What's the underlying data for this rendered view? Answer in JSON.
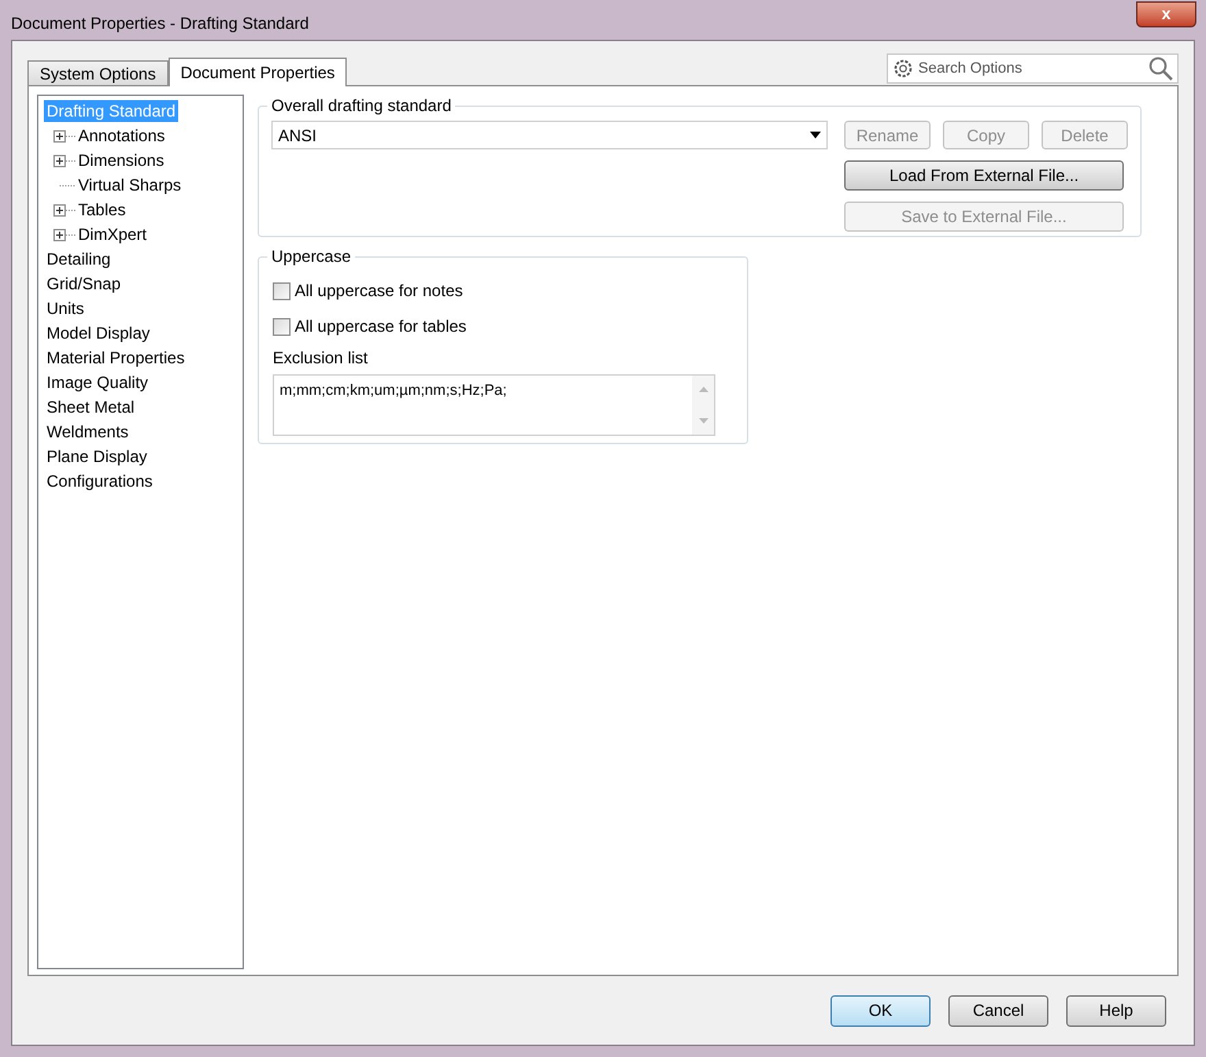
{
  "window": {
    "title": "Document Properties - Drafting Standard",
    "close_label": "x"
  },
  "tabs": [
    {
      "label": "System Options",
      "selected": false
    },
    {
      "label": "Document Properties",
      "selected": true
    }
  ],
  "search": {
    "placeholder": "Search Options"
  },
  "tree": [
    {
      "label": "Drafting Standard",
      "selected": true,
      "children": [
        {
          "label": "Annotations",
          "kind": "expandable",
          "selected": false
        },
        {
          "label": "Dimensions",
          "kind": "expandable",
          "selected": false
        },
        {
          "label": "Virtual Sharps",
          "kind": "leaf",
          "selected": false
        },
        {
          "label": "Tables",
          "kind": "expandable",
          "selected": false
        },
        {
          "label": "DimXpert",
          "kind": "expandable",
          "selected": false
        }
      ]
    },
    {
      "label": "Detailing",
      "selected": false
    },
    {
      "label": "Grid/Snap",
      "selected": false
    },
    {
      "label": "Units",
      "selected": false
    },
    {
      "label": "Model Display",
      "selected": false
    },
    {
      "label": "Material Properties",
      "selected": false
    },
    {
      "label": "Image Quality",
      "selected": false
    },
    {
      "label": "Sheet Metal",
      "selected": false
    },
    {
      "label": "Weldments",
      "selected": false
    },
    {
      "label": "Plane Display",
      "selected": false
    },
    {
      "label": "Configurations",
      "selected": false
    }
  ],
  "drafting_standard": {
    "title": "Overall drafting standard",
    "value": "ANSI",
    "buttons": [
      {
        "label": "Rename",
        "disabled": true
      },
      {
        "label": "Copy",
        "disabled": true
      },
      {
        "label": "Delete",
        "disabled": true
      }
    ],
    "file_buttons": [
      {
        "label": "Load From External File...",
        "disabled": false
      },
      {
        "label": "Save to External File...",
        "disabled": true
      }
    ]
  },
  "uppercase": {
    "title": "Uppercase",
    "checkboxes": [
      {
        "label": "All uppercase for notes",
        "checked": false
      },
      {
        "label": "All uppercase for tables",
        "checked": false
      }
    ],
    "exclusion_label": "Exclusion list",
    "exclusion_value": "m;mm;cm;km;um;µm;nm;s;Hz;Pa;"
  },
  "footer_buttons": [
    {
      "label": "OK",
      "default": true
    },
    {
      "label": "Cancel",
      "default": false
    },
    {
      "label": "Help",
      "default": false
    }
  ]
}
